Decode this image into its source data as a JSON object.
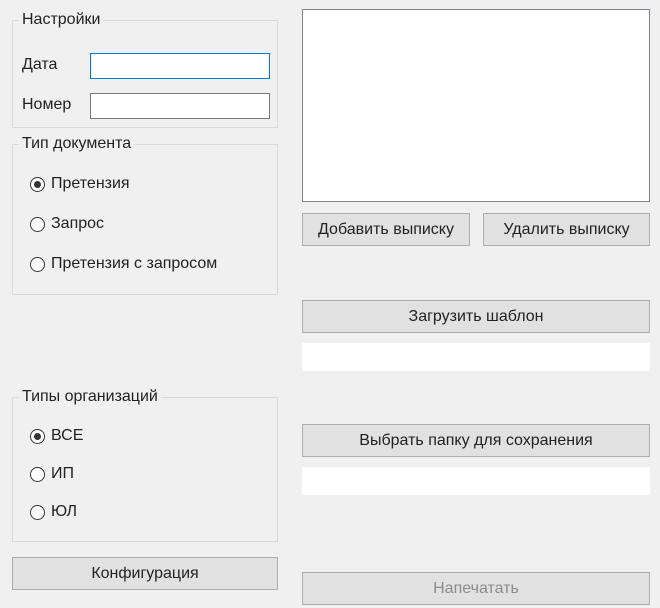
{
  "settings": {
    "group_label": "Настройки",
    "date_label": "Дата",
    "number_label": "Номер",
    "date_value": "",
    "number_value": ""
  },
  "doc_type": {
    "group_label": "Тип документа",
    "options": [
      "Претензия",
      "Запрос",
      "Претензия с запросом"
    ],
    "selected_index": 0
  },
  "org_type": {
    "group_label": "Типы организаций",
    "options": [
      "ВСЕ",
      "ИП",
      "ЮЛ"
    ],
    "selected_index": 0
  },
  "buttons": {
    "config": "Конфигурация",
    "add_extract": "Добавить выписку",
    "remove_extract": "Удалить выписку",
    "load_template": "Загрузить шаблон",
    "choose_folder": "Выбрать папку для сохранения",
    "print": "Напечатать"
  },
  "template_path": "",
  "save_path": ""
}
